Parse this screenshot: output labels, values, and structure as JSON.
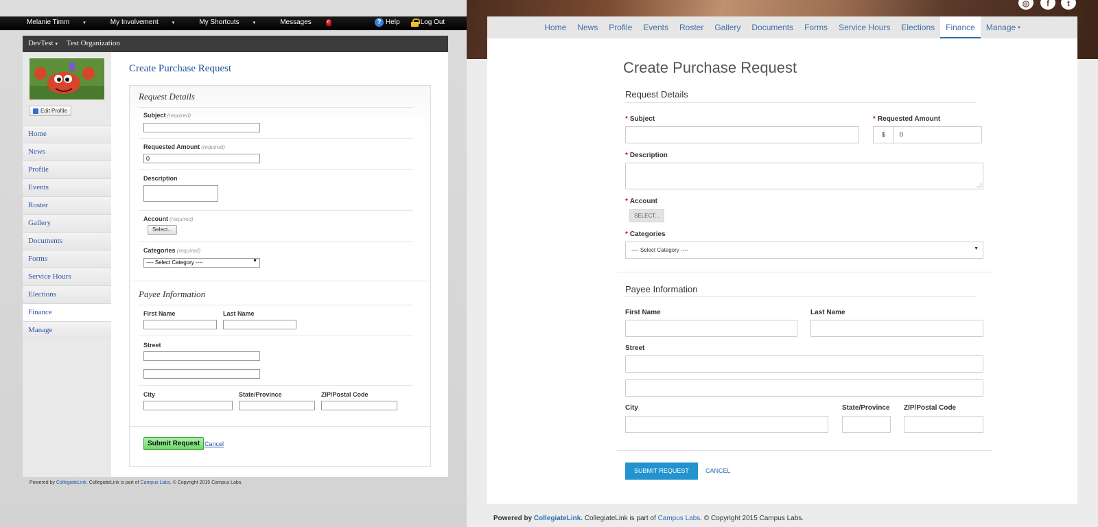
{
  "old_ui": {
    "topnav": {
      "items": [
        {
          "label": "Melanie Timm",
          "caret": "▾"
        },
        {
          "label": "My Involvement",
          "caret": "▾"
        },
        {
          "label": "My Shortcuts",
          "caret": "▾"
        },
        {
          "label": "Messages",
          "badge": "6"
        }
      ],
      "help_label": "Help",
      "logout_label": "Log Out"
    },
    "org": {
      "name": "DevTest",
      "caret": "▾",
      "org_label": "Test Organization"
    },
    "edit_profile_label": "Edit Profile",
    "sidebar_items": [
      "Home",
      "News",
      "Profile",
      "Events",
      "Roster",
      "Gallery",
      "Documents",
      "Forms",
      "Service Hours",
      "Elections",
      "Finance",
      "Manage"
    ],
    "active_item": "Finance",
    "form": {
      "title": "Create Purchase Request",
      "request_details_title": "Request Details",
      "required_note": "(required)",
      "subject_label": "Subject",
      "requested_amount_label": "Requested Amount",
      "requested_amount_value": "0",
      "description_label": "Description",
      "account_label": "Account",
      "select_button_label": "Select...",
      "categories_label": "Categories",
      "categories_value": "---- Select Category ----",
      "payee_title": "Payee Information",
      "first_name_label": "First Name",
      "last_name_label": "Last Name",
      "street_label": "Street",
      "city_label": "City",
      "state_label": "State/Province",
      "zip_label": "ZIP/Postal Code",
      "submit_label": "Submit Request",
      "cancel_label": "Cancel"
    },
    "footer": {
      "powered_by": "Powered by",
      "collegiatelink": "CollegiateLink.",
      "part_of": "CollegiateLink is part of",
      "campus_labs": "Campus Labs",
      "copyright": ". © Copyright 2015 Campus Labs."
    }
  },
  "new_ui": {
    "tabs": [
      "Home",
      "News",
      "Profile",
      "Events",
      "Roster",
      "Gallery",
      "Documents",
      "Forms",
      "Service Hours",
      "Elections",
      "Finance",
      "Manage"
    ],
    "active_tab": "Finance",
    "manage_caret": "▾",
    "social_icons": [
      "globe-icon",
      "facebook-icon",
      "twitter-icon"
    ],
    "form": {
      "title": "Create Purchase Request",
      "request_details_title": "Request Details",
      "required_marker": "*",
      "subject_label": "Subject",
      "requested_amount_label": "Requested Amount",
      "currency_symbol": "$",
      "requested_amount_value": "0",
      "description_label": "Description",
      "account_label": "Account",
      "select_button_label": "SELECT...",
      "categories_label": "Categories",
      "categories_value": "---- Select Category ----",
      "payee_title": "Payee Information",
      "first_name_label": "First Name",
      "last_name_label": "Last Name",
      "street_label": "Street",
      "city_label": "City",
      "state_label": "State/Province",
      "zip_label": "ZIP/Postal Code",
      "submit_label": "SUBMIT REQUEST",
      "cancel_label": "CANCEL"
    },
    "footer": {
      "powered_by": "Powered by",
      "collegiatelink": "CollegiateLink.",
      "part_of": "CollegiateLink is part of",
      "campus_labs": "Campus Labs",
      "copyright": ". © Copyright 2015 Campus Labs."
    }
  },
  "colors": {
    "old_link": "#2a55a8",
    "old_title": "#1f4e9d",
    "old_submit": "#6ed86a",
    "new_link": "#2a6fb4",
    "new_submit": "#2293cf",
    "required_star": "#c81e1e",
    "badge": "#c0161b"
  }
}
